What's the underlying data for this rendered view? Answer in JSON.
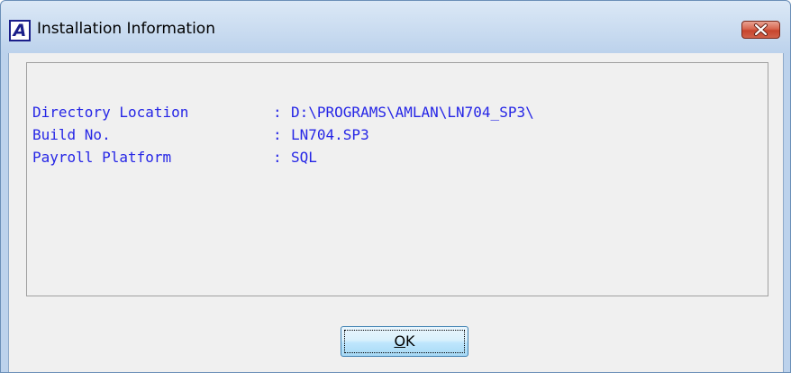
{
  "window": {
    "title": "Installation Information",
    "icon": "amlan-app-icon",
    "icon_letter": "A",
    "close_icon": "close-icon"
  },
  "info": {
    "separator": ":",
    "rows": [
      {
        "label": "Directory Location",
        "value": "D:\\PROGRAMS\\AMLAN\\LN704_SP3\\"
      },
      {
        "label": "Build No.",
        "value": "LN704.SP3"
      },
      {
        "label": "Payroll Platform",
        "value": "SQL"
      }
    ]
  },
  "buttons": {
    "ok_mnemonic": "O",
    "ok_rest": "K"
  },
  "colors": {
    "info_text": "#2626e6",
    "close_button": "#c7452d",
    "title_bar": "#c6d9ef",
    "client_background": "#f0f0f0"
  }
}
